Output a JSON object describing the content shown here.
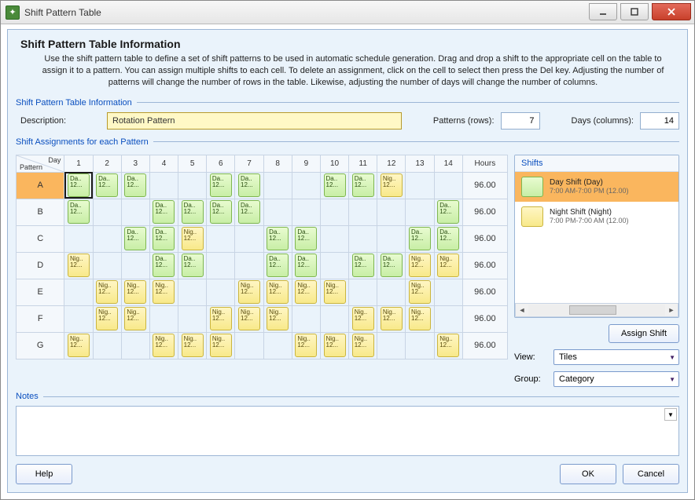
{
  "window": {
    "title": "Shift Pattern Table"
  },
  "dialog": {
    "title": "Shift Pattern Table Information",
    "instructions": "Use the shift pattern table to define a set of shift patterns to be used in automatic schedule generation. Drag and drop a shift to the appropriate cell on the table to assign it to a pattern. You can assign multiple shifts to each cell. To delete an assignment, click on the cell to select then press the Del key.  Adjusting the number of patterns will change the number of rows in the table. Likewise, adjusting the number of days will change the number of columns."
  },
  "legends": {
    "info": "Shift Pattern Table Information",
    "assignments": "Shift Assignments for each Pattern",
    "notes": "Notes"
  },
  "fields": {
    "description_label": "Description:",
    "description_value": "Rotation Pattern",
    "patterns_label": "Patterns (rows):",
    "patterns_value": "7",
    "days_label": "Days (columns):",
    "days_value": "14"
  },
  "grid": {
    "corner_day": "Day",
    "corner_pattern": "Pattern",
    "day_headers": [
      "1",
      "2",
      "3",
      "4",
      "5",
      "6",
      "7",
      "8",
      "9",
      "10",
      "11",
      "12",
      "13",
      "14"
    ],
    "hours_header": "Hours",
    "cell_day_top": "Da..",
    "cell_day_bot": "12...",
    "cell_night_top": "Nig..",
    "cell_night_bot": "12...",
    "rows": [
      {
        "label": "A",
        "hours": "96.00",
        "cells": [
          "D",
          "D",
          "D",
          "",
          "",
          "D",
          "D",
          "",
          "",
          "D",
          "D",
          "N",
          "",
          ""
        ]
      },
      {
        "label": "B",
        "hours": "96.00",
        "cells": [
          "D",
          "",
          "",
          "D",
          "D",
          "D",
          "D",
          "",
          "",
          "",
          "",
          "",
          "",
          "D"
        ]
      },
      {
        "label": "C",
        "hours": "96.00",
        "cells": [
          "",
          "",
          "D",
          "D",
          "N",
          "",
          "",
          "D",
          "D",
          "",
          "",
          "",
          "D",
          "D"
        ]
      },
      {
        "label": "D",
        "hours": "96.00",
        "cells": [
          "N",
          "",
          "",
          "D",
          "D",
          "",
          "",
          "D",
          "D",
          "",
          "D",
          "D",
          "N",
          "N"
        ]
      },
      {
        "label": "E",
        "hours": "96.00",
        "cells": [
          "",
          "N",
          "N",
          "N",
          "",
          "",
          "N",
          "N",
          "N",
          "N",
          "",
          "",
          "N",
          ""
        ]
      },
      {
        "label": "F",
        "hours": "96.00",
        "cells": [
          "",
          "N",
          "N",
          "",
          "",
          "N",
          "N",
          "N",
          "",
          "",
          "N",
          "N",
          "N",
          ""
        ]
      },
      {
        "label": "G",
        "hours": "96.00",
        "cells": [
          "N",
          "",
          "",
          "N",
          "N",
          "N",
          "",
          "",
          "N",
          "N",
          "N",
          "",
          "",
          "N"
        ]
      }
    ],
    "selected": {
      "row": 0,
      "col": 0
    }
  },
  "shifts": {
    "header": "Shifts",
    "items": [
      {
        "name": "Day Shift (Day)",
        "detail": "7:00 AM-7:00 PM (12.00)",
        "type": "day",
        "selected": true
      },
      {
        "name": "Night Shift (Night)",
        "detail": "7:00 PM-7:00 AM (12.00)",
        "type": "night",
        "selected": false
      }
    ],
    "assign_label": "Assign Shift",
    "view_label": "View:",
    "view_value": "Tiles",
    "group_label": "Group:",
    "group_value": "Category"
  },
  "buttons": {
    "help": "Help",
    "ok": "OK",
    "cancel": "Cancel"
  }
}
